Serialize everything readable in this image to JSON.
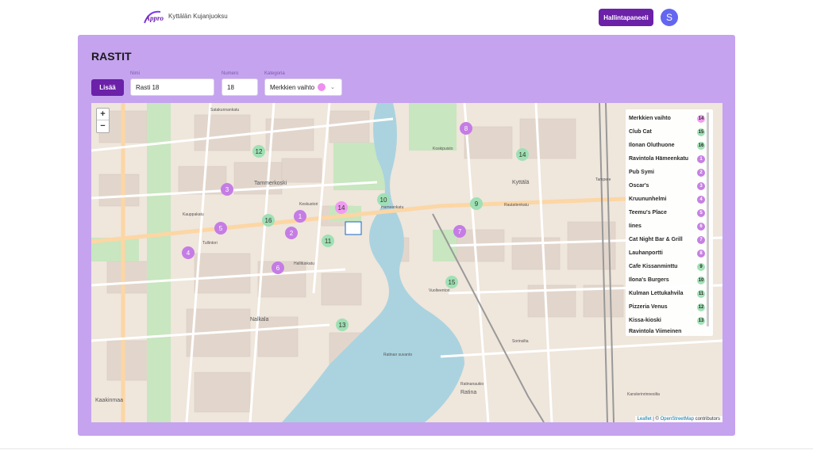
{
  "header": {
    "app_title": "Kyttälän Kujanjuoksu",
    "admin_button": "Hallintapaneeli",
    "avatar_initial": "S",
    "logo_text": "Appro"
  },
  "page": {
    "heading": "RASTIT"
  },
  "form": {
    "add_button": "Lisää",
    "name_label": "Nimi",
    "name_value": "Rasti 18",
    "number_label": "Numero",
    "number_value": "18",
    "category_label": "Kategoria",
    "category_value": "Merkkien vaihto",
    "category_color": "#ee8ff0"
  },
  "map": {
    "zoom_in": "+",
    "zoom_out": "−",
    "attribution_leaflet": "Leaflet",
    "attribution_sep": "|",
    "attribution_copy": "©",
    "attribution_osm": "OpenStreetMap",
    "attribution_contrib": "contributors",
    "street_labels": [
      "Satakunnankatu",
      "Tammerkoski",
      "Hämeenkatu",
      "Keskustori",
      "Tullintori",
      "Kauppakatu",
      "Hallituskatu",
      "Näsilinnankatu",
      "Nalkala",
      "Kaakinmaa",
      "Koskipuisto",
      "Kyttälä",
      "Ratinan suvanto",
      "Ratina",
      "Ratinanaukio",
      "Vuolteentori",
      "Tampere",
      "Sorinsilta",
      "Tampereen Keskustori",
      "Kanslerinrinnesilta",
      "Koskikeskus",
      "Rautatienkatu",
      "Hatanpään valtatie"
    ],
    "markers": [
      {
        "num": "1",
        "type": "purple"
      },
      {
        "num": "2",
        "type": "purple"
      },
      {
        "num": "3",
        "type": "purple"
      },
      {
        "num": "4",
        "type": "purple"
      },
      {
        "num": "5",
        "type": "purple"
      },
      {
        "num": "6",
        "type": "purple"
      },
      {
        "num": "7",
        "type": "purple"
      },
      {
        "num": "8",
        "type": "purple"
      },
      {
        "num": "9",
        "type": "green"
      },
      {
        "num": "10",
        "type": "green"
      },
      {
        "num": "11",
        "type": "green"
      },
      {
        "num": "12",
        "type": "green"
      },
      {
        "num": "13",
        "type": "green"
      },
      {
        "num": "14",
        "type": "green"
      },
      {
        "num": "14",
        "type": "pink"
      },
      {
        "num": "15",
        "type": "green"
      },
      {
        "num": "16",
        "type": "green"
      }
    ],
    "legend": [
      {
        "name": "Merkkien vaihto",
        "num": "14",
        "type": "pink"
      },
      {
        "name": "Club Cat",
        "num": "15",
        "type": "green"
      },
      {
        "name": "Ilonan Oluthuone",
        "num": "16",
        "type": "green"
      },
      {
        "name": "Ravintola Hämeenkatu",
        "num": "1",
        "type": "purple"
      },
      {
        "name": "Pub Symi",
        "num": "2",
        "type": "purple"
      },
      {
        "name": "Oscar's",
        "num": "3",
        "type": "purple"
      },
      {
        "name": "Kruununhelmi",
        "num": "4",
        "type": "purple"
      },
      {
        "name": "Teemu's Place",
        "num": "5",
        "type": "purple"
      },
      {
        "name": "Iines",
        "num": "6",
        "type": "purple"
      },
      {
        "name": "Cat Night Bar & Grill",
        "num": "7",
        "type": "purple"
      },
      {
        "name": "Lauhanportti",
        "num": "8",
        "type": "purple"
      },
      {
        "name": "Cafe Kissanminttu",
        "num": "9",
        "type": "green"
      },
      {
        "name": "Ilona's Burgers",
        "num": "10",
        "type": "green"
      },
      {
        "name": "Kulman Lettukahvila",
        "num": "11",
        "type": "green"
      },
      {
        "name": "Pizzeria Venus",
        "num": "12",
        "type": "green"
      },
      {
        "name": "Kissa-kioski",
        "num": "13",
        "type": "green"
      },
      {
        "name": "Ravintola Viimeinen",
        "num": "",
        "type": "green"
      }
    ]
  },
  "colors": {
    "accent": "#6b21a8",
    "panel": "#c5a3ef",
    "purple_marker": "#c57ce4",
    "green_marker": "#9fe0b4",
    "pink_marker": "#f09cf0"
  }
}
